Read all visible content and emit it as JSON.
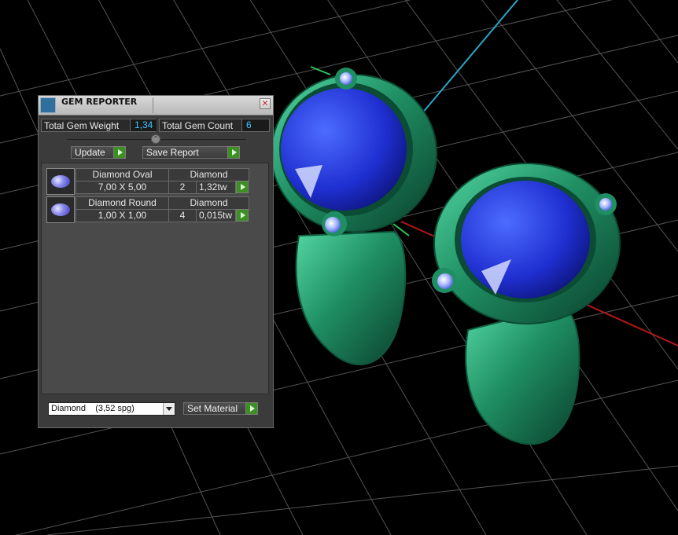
{
  "panel": {
    "title": "GEM REPORTER",
    "close_glyph": "✕",
    "total_weight_label": "Total Gem Weight",
    "total_weight_value": "1,34",
    "total_count_label": "Total Gem Count",
    "total_count_value": "6",
    "update_label": "Update",
    "save_report_label": "Save Report",
    "gems": [
      {
        "name": "Diamond Oval",
        "material": "Diamond",
        "size": "7,00 X 5,00",
        "qty": "2",
        "weight": "1,32tw"
      },
      {
        "name": "Diamond Round",
        "material": "Diamond",
        "size": "1,00 X 1,00",
        "qty": "4",
        "weight": "0,015tw"
      }
    ],
    "material_select": "Diamond    (3,52 spg)",
    "set_material_label": "Set Material"
  },
  "colors": {
    "accent_value": "#3fc4ff",
    "play_button": "#3d8f24",
    "ring_metal": "#1f8f63",
    "gemstone": "#1f2fd0"
  },
  "icons": {
    "title": "gem-reporter-app-icon",
    "close": "close-icon",
    "play": "play-arrow-icon",
    "dropdown": "chevron-down-icon"
  }
}
